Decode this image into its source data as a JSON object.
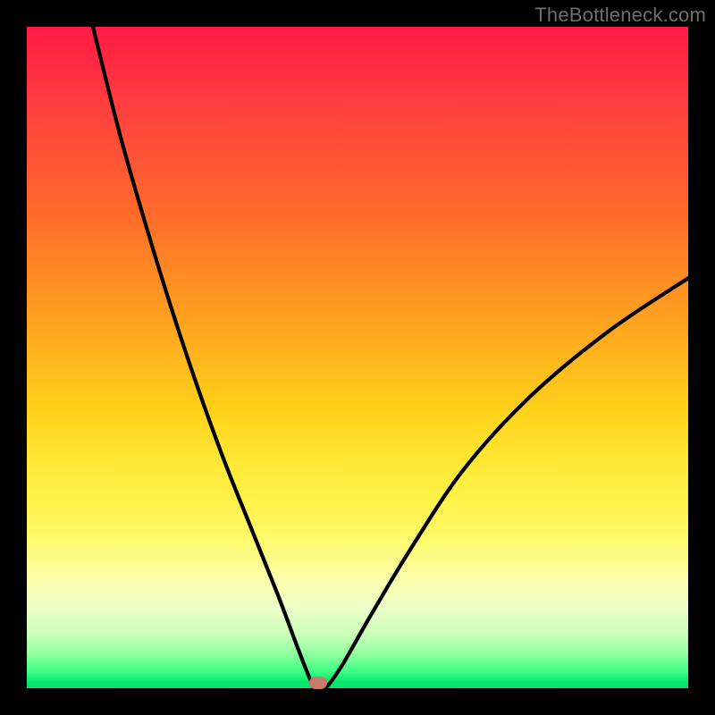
{
  "watermark": "TheBottleneck.com",
  "colors": {
    "frame": "#000000",
    "gradient_top": "#ff1a44",
    "gradient_bottom": "#07e06a",
    "curve": "#000000",
    "marker": "#c77a6d",
    "watermark_text": "#6e6e6e"
  },
  "chart_data": {
    "type": "line",
    "title": "",
    "xlabel": "",
    "ylabel": "",
    "x_range": [
      0,
      100
    ],
    "y_range": [
      0,
      100
    ],
    "notes": "V-shaped bottleneck curve on a vertical red→green gradient. Minimum at x≈44 where y≈0. Left branch starts near (10, 100); right branch reaches ≈(100, 62). A small rounded marker sits at the minimum.",
    "series": [
      {
        "name": "bottleneck-curve",
        "x": [
          10,
          14,
          18,
          22,
          26,
          30,
          34,
          38,
          41,
          43,
          44,
          45,
          46,
          48,
          52,
          58,
          66,
          76,
          88,
          100
        ],
        "y": [
          100,
          84,
          70,
          57,
          45,
          34,
          24,
          14,
          6,
          1,
          0,
          0,
          1,
          4,
          11,
          21,
          33,
          44,
          54,
          62
        ]
      }
    ],
    "marker": {
      "x": 44,
      "y": 0
    }
  }
}
